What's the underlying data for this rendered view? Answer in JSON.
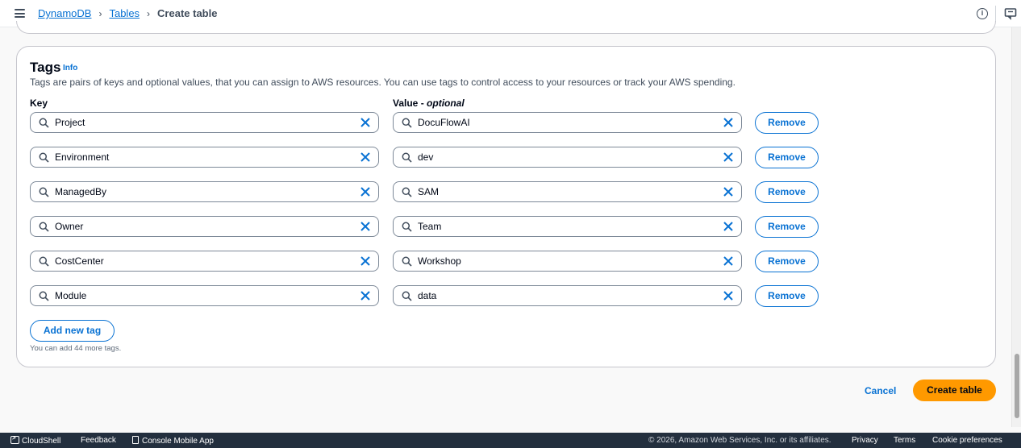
{
  "breadcrumb": {
    "items": [
      "DynamoDB",
      "Tables"
    ],
    "current": "Create table"
  },
  "header_icons": [
    "menu-icon",
    "info-icon",
    "feedback-icon"
  ],
  "tags": {
    "title": "Tags",
    "info_link": "Info",
    "description": "Tags are pairs of keys and optional values, that you can assign to AWS resources. You can use tags to control access to your resources or track your AWS spending.",
    "key_header": "Key",
    "value_header": "Value",
    "value_header_suffix": "optional",
    "rows": [
      {
        "key": "Project",
        "value": "DocuFlowAI",
        "remove_label": "Remove"
      },
      {
        "key": "Environment",
        "value": "dev",
        "remove_label": "Remove"
      },
      {
        "key": "ManagedBy",
        "value": "SAM",
        "remove_label": "Remove"
      },
      {
        "key": "Owner",
        "value": "Team",
        "remove_label": "Remove"
      },
      {
        "key": "CostCenter",
        "value": "Workshop",
        "remove_label": "Remove"
      },
      {
        "key": "Module",
        "value": "data",
        "remove_label": "Remove"
      }
    ],
    "add_button": "Add new tag",
    "add_hint": "You can add 44 more tags."
  },
  "actions": {
    "cancel": "Cancel",
    "create": "Create table"
  },
  "footer": {
    "cloudshell": "CloudShell",
    "feedback": "Feedback",
    "mobile_app": "Console Mobile App",
    "copyright": "© 2026, Amazon Web Services, Inc. or its affiliates.",
    "privacy": "Privacy",
    "terms": "Terms",
    "cookies": "Cookie preferences"
  },
  "colors": {
    "link": "#0972d3",
    "primary_button": "#ff9900",
    "footer_bg": "#232f3e"
  }
}
